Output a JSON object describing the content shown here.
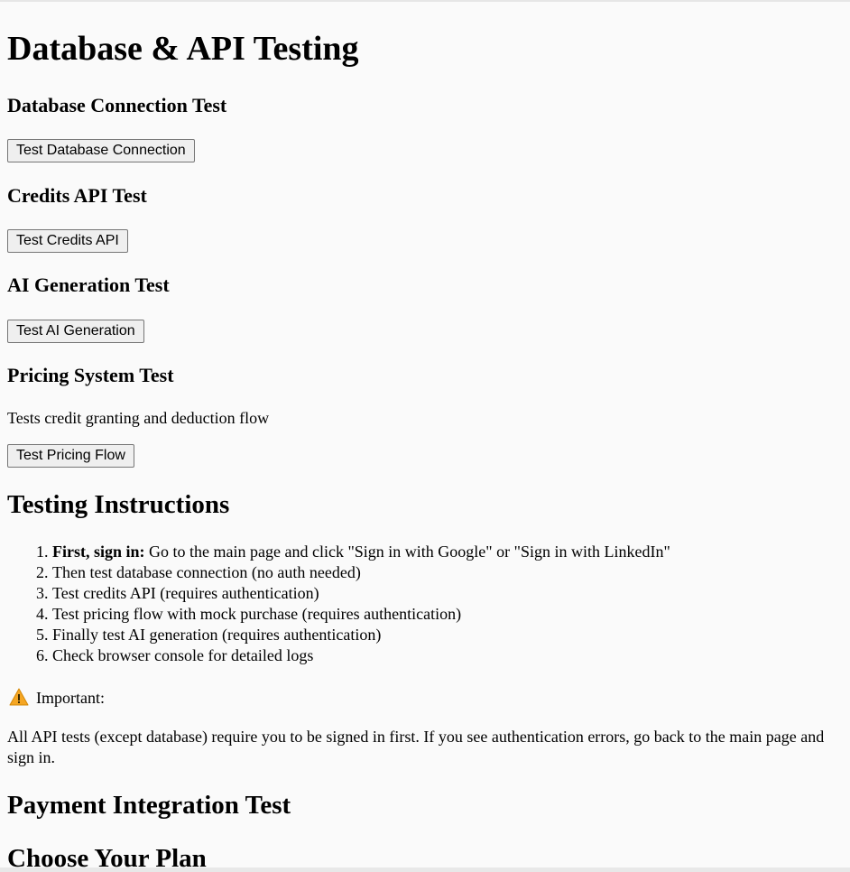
{
  "page": {
    "title": "Database & API Testing"
  },
  "sections": [
    {
      "heading": "Database Connection Test",
      "button": "Test Database Connection"
    },
    {
      "heading": "Credits API Test",
      "button": "Test Credits API"
    },
    {
      "heading": "AI Generation Test",
      "button": "Test AI Generation"
    },
    {
      "heading": "Pricing System Test",
      "description": "Tests credit granting and deduction flow",
      "button": "Test Pricing Flow"
    }
  ],
  "instructions": {
    "heading": "Testing Instructions",
    "items": [
      {
        "bold": "First, sign in:",
        "text": " Go to the main page and click \"Sign in with Google\" or \"Sign in with LinkedIn\""
      },
      {
        "text": "Then test database connection (no auth needed)"
      },
      {
        "text": "Test credits API (requires authentication)"
      },
      {
        "text": "Test pricing flow with mock purchase (requires authentication)"
      },
      {
        "text": "Finally test AI generation (requires authentication)"
      },
      {
        "text": "Check browser console for detailed logs"
      }
    ]
  },
  "important": {
    "icon": "warning-icon",
    "label": "Important:",
    "text": "All API tests (except database) require you to be signed in first. If you see authentication errors, go back to the main page and sign in."
  },
  "payment": {
    "heading": "Payment Integration Test",
    "subheading": "Choose Your Plan"
  },
  "colors": {
    "background": "#fafafa",
    "warning": "#f5a623"
  }
}
